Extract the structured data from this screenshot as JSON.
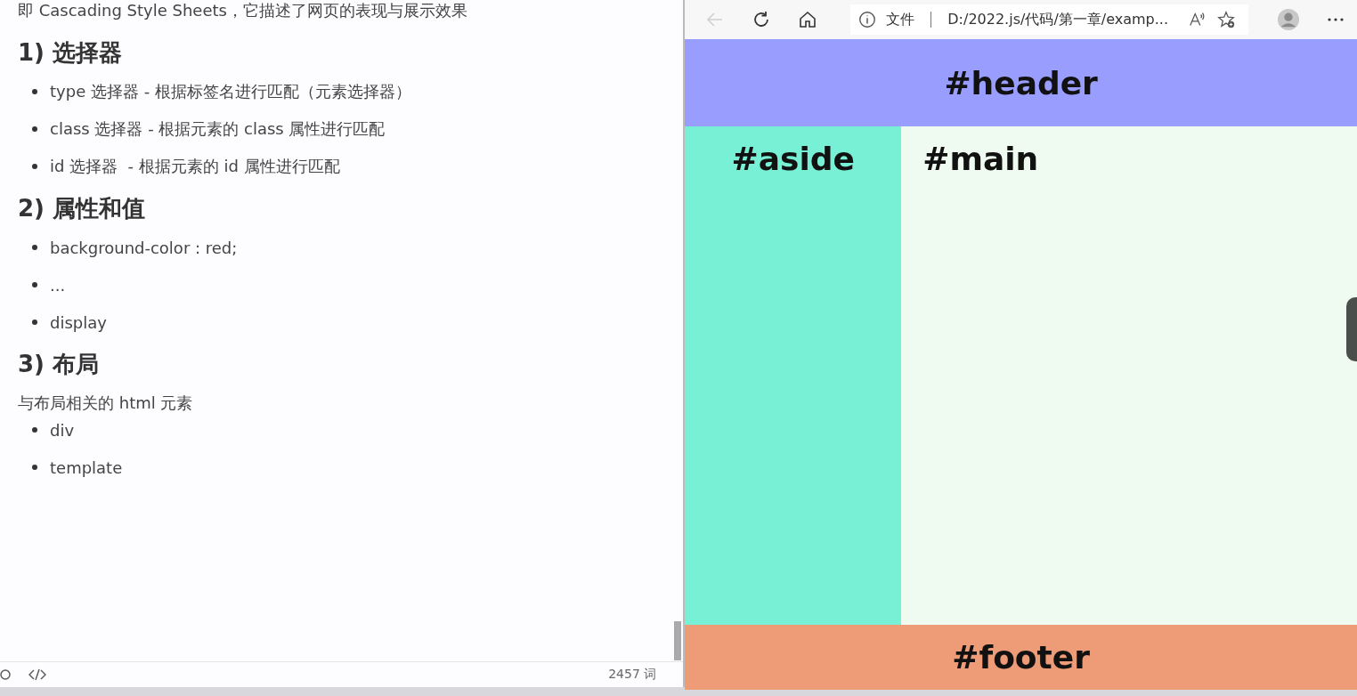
{
  "editor": {
    "intro": "即 Cascading Style Sheets，它描述了网页的表现与展示效果",
    "sections": [
      {
        "heading": "1) 选择器",
        "blocks": [
          {
            "kind": "list",
            "items": [
              "type 选择器 - 根据标签名进行匹配（元素选择器）",
              "class 选择器 - 根据元素的 class 属性进行匹配",
              "id 选择器  - 根据元素的 id 属性进行匹配"
            ]
          }
        ]
      },
      {
        "heading": "2) 属性和值",
        "blocks": [
          {
            "kind": "list",
            "items": [
              "background-color : red;",
              "...",
              "display"
            ]
          }
        ]
      },
      {
        "heading": "3) 布局",
        "blocks": [
          {
            "kind": "paragraph",
            "text": "与布局相关的 html 元素"
          },
          {
            "kind": "list",
            "items": [
              "div",
              "template"
            ]
          }
        ]
      }
    ],
    "status_bar": {
      "word_count": "2457 词"
    }
  },
  "browser": {
    "back_disabled": true,
    "address": {
      "scheme": "文件",
      "url": "D:/2022.js/代码/第一章/examp..."
    },
    "page": {
      "header": "#header",
      "aside": "#aside",
      "main": "#main",
      "footer": "#footer"
    }
  }
}
